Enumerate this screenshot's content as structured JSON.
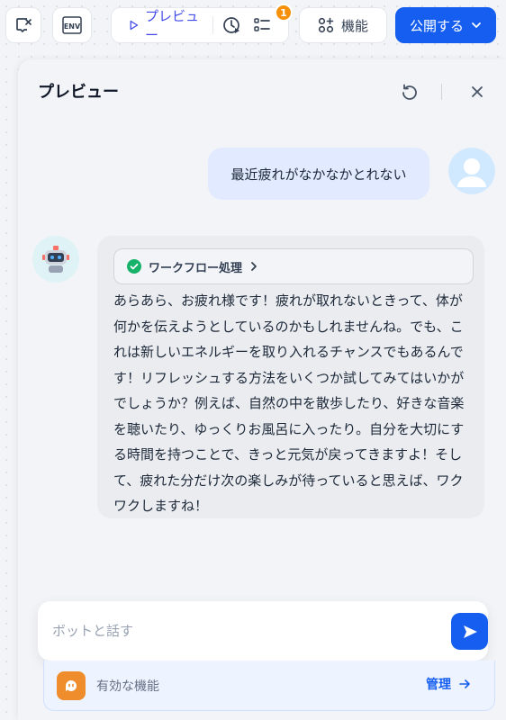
{
  "toolbar": {
    "checklist_icon": "check-clear-icon",
    "env_label": "ENV",
    "preview_label": "プレビュー",
    "badge_count": "1",
    "features_label": "機能",
    "publish_label": "公開する"
  },
  "panel": {
    "title": "プレビュー"
  },
  "chat": {
    "user_message": "最近疲れがなかなかとれない",
    "workflow_label": "ワークフロー処理",
    "bot_message": "あらあら、お疲れ様です！疲れが取れないときって、体が何かを伝えようとしているのかもしれませんね。でも、これは新しいエネルギーを取り入れるチャンスでもあるんです！リフレッシュする方法をいくつか試してみてはいかがでしょうか？例えば、自然の中を散歩したり、好きな音楽を聴いたり、ゆっくりお風呂に入ったり。自分を大切にする時間を持つことで、きっと元気が戻ってきますよ！そして、疲れた分だけ次の楽しみが待っていると思えば、ワクワクしますね！"
  },
  "input": {
    "placeholder": "ボットと話す",
    "value": ""
  },
  "features": {
    "label": "有効な機能",
    "manage_label": "管理"
  },
  "colors": {
    "accent": "#155eef",
    "badge": "#f79009",
    "feature_icon": "#ef8c2b"
  }
}
